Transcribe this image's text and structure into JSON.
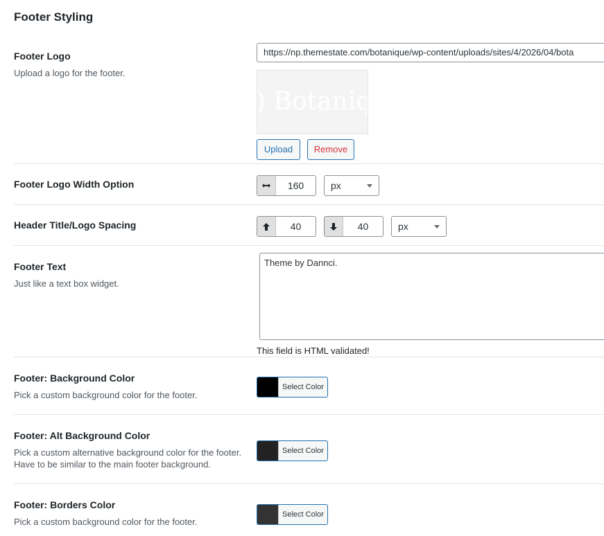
{
  "section_title": "Footer Styling",
  "footer_logo": {
    "label": "Footer Logo",
    "description": "Upload a logo for the footer.",
    "url_value": "https://np.themestate.com/botanique/wp-content/uploads/sites/4/2026/04/bota",
    "preview_text": ") Botaniq",
    "upload_label": "Upload",
    "remove_label": "Remove"
  },
  "logo_width": {
    "label": "Footer Logo Width Option",
    "value": "160",
    "unit": "px",
    "icon": "horizontal-arrows-icon"
  },
  "header_spacing": {
    "label": "Header Title/Logo Spacing",
    "top_value": "40",
    "bottom_value": "40",
    "unit": "px"
  },
  "footer_text": {
    "label": "Footer Text",
    "description": "Just like a text box widget.",
    "value": "Theme by Dannci.",
    "validation_note": "This field is HTML validated!"
  },
  "bg_color": {
    "label": "Footer: Background Color",
    "description": "Pick a custom background color for the footer.",
    "button_label": "Select Color",
    "swatch": "#000000"
  },
  "alt_bg_color": {
    "label": "Footer: Alt Background Color",
    "description_line1": "Pick a custom alternative background color for the footer.",
    "description_line2": "Have to be similar to the main footer background.",
    "button_label": "Select Color",
    "swatch": "#222222"
  },
  "borders_color": {
    "label": "Footer: Borders Color",
    "description": "Pick a custom background color for the footer.",
    "button_label": "Select Color",
    "swatch": "#333333"
  },
  "colors": {
    "accent": "#2271b1",
    "danger": "#d63638",
    "divider": "#e3e3e3"
  }
}
